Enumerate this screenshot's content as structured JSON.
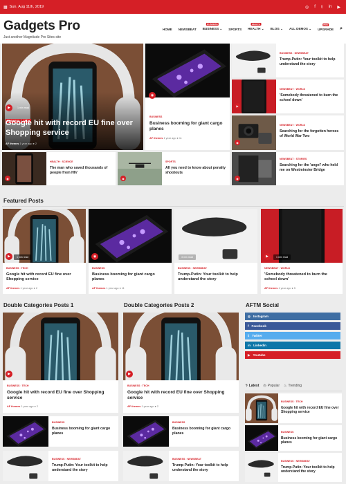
{
  "topbar": {
    "date": "Sun. Aug 11th, 2019",
    "social_icons": [
      "instagram-icon",
      "facebook-icon",
      "twitter-icon",
      "linkedin-icon",
      "youtube-icon"
    ]
  },
  "header": {
    "site_title": "Gadgets Pro",
    "tagline": "Just another Magnitude Pro Sites site"
  },
  "nav": {
    "items": [
      {
        "label": "HOME",
        "badge": ""
      },
      {
        "label": "NEWSBEAT",
        "badge": ""
      },
      {
        "label": "BUSINESS ⌄",
        "badge": "BUSINESS"
      },
      {
        "label": "SPORTS",
        "badge": ""
      },
      {
        "label": "HEALTH ⌄",
        "badge": "HEALTH"
      },
      {
        "label": "BLOG ⌄",
        "badge": ""
      },
      {
        "label": "ALL DEMOS ⌄",
        "badge": ""
      },
      {
        "label": "UPGRADE",
        "badge": "PRO"
      }
    ]
  },
  "hero": {
    "main": {
      "tags": [
        "BUSINESS",
        "TECH"
      ],
      "read": "1 min read",
      "title": "Google hit with record EU fine over Shopping service",
      "author": "AF themes",
      "meta": "1 year ago ● 2"
    },
    "second": {
      "tag": "BUSINESS",
      "title": "Business booming for giant cargo planes",
      "author": "AF themes",
      "meta": "1 year ago ● 11"
    },
    "right": [
      {
        "tag": "BUSINESS ◦ NEWSBEAT",
        "title": "Trump-Putin: Your toolkit to help understand the story"
      },
      {
        "tag": "NEWSBEAT ◦ WORLD",
        "title": "'Somebody threatened to burn the school down'"
      },
      {
        "tag": "NEWSBEAT ◦ WORLD",
        "title": "Searching for the forgotten heroes of World War Two"
      },
      {
        "tag": "NEWSBEAT ◦ STORIES",
        "title": "Searching for the 'angel' who held me on Westminster Bridge"
      }
    ],
    "bottom": [
      {
        "tag": "HEALTH ◦ SCIENCE",
        "title": "The man who saved thousands of people from HIV"
      },
      {
        "tag": "SPORTS",
        "title": "All you need to know about penalty shootouts"
      }
    ]
  },
  "featured": {
    "heading": "Featured Posts",
    "posts": [
      {
        "tag": "BUSINESS ◦ TECH",
        "read": "1 min read",
        "title": "Google hit with record EU fine over Shopping service",
        "author": "AF themes",
        "meta": "1 year ago ● 2"
      },
      {
        "tag": "BUSINESS",
        "read": "",
        "title": "Business booming for giant cargo planes",
        "author": "AF themes",
        "meta": "1 year ago ● 11"
      },
      {
        "tag": "BUSINESS ◦ NEWSBEAT",
        "read": "3 min read",
        "title": "Trump-Putin: Your toolkit to help understand the story",
        "author": "",
        "meta": ""
      },
      {
        "tag": "NEWSBEAT ◦ WORLD",
        "read": "1 min read",
        "title": "'Somebody threatened to burn the school down'",
        "author": "AF themes",
        "meta": "1 year ago ● 5"
      }
    ]
  },
  "double": {
    "col1": {
      "heading": "Double Categories Posts 1"
    },
    "col2": {
      "heading": "Double Categories Posts 2"
    },
    "main": {
      "tag": "BUSINESS ◦ TECH",
      "title": "Google hit with record EU fine over Shopping service",
      "author": "AF themes",
      "meta": "1 year ago ● 2"
    },
    "list": [
      {
        "tag": "BUSINESS",
        "title": "Business booming for giant cargo planes"
      },
      {
        "tag": "BUSINESS ◦ NEWSBEAT",
        "title": "Trump-Putin: Your toolkit to help understand the story"
      }
    ]
  },
  "sidebar": {
    "heading": "AFTM Social",
    "social": [
      {
        "label": "Instagram",
        "color": "#3f6ea3"
      },
      {
        "label": "Facebook",
        "color": "#3b5998"
      },
      {
        "label": "Twitter",
        "color": "#55acee"
      },
      {
        "label": "Linkedin",
        "color": "#0e76a8"
      },
      {
        "label": "Youtube",
        "color": "#d51f26"
      }
    ],
    "tabs": [
      "Latest",
      "Popular",
      "Trending"
    ],
    "latest": [
      {
        "tag": "BUSINESS ◦ TECH",
        "title": "Google hit with record EU fine over Shopping service"
      },
      {
        "tag": "BUSINESS",
        "title": "Business booming for giant cargo planes"
      },
      {
        "tag": "BUSINESS ◦ NEWSBEAT",
        "title": "Trump-Putin: Your toolkit to help understand the story"
      }
    ]
  },
  "colors": {
    "accent": "#d51f26",
    "bg": "#ececec"
  }
}
